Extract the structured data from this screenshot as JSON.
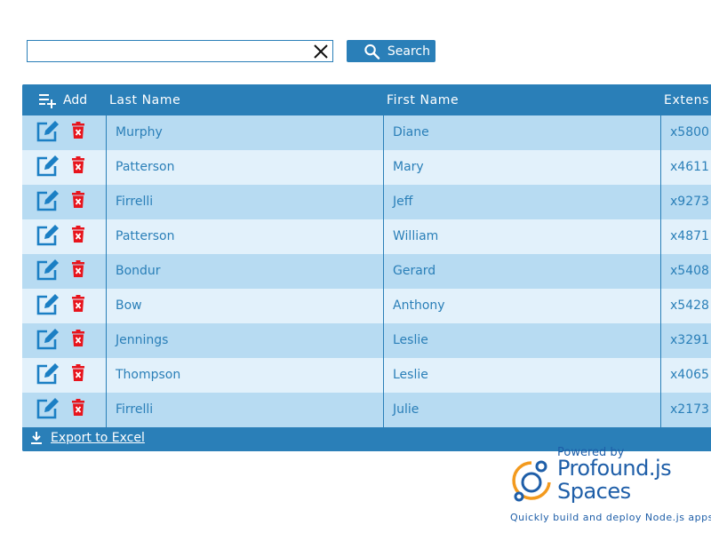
{
  "search": {
    "value": "",
    "button_label": "Search"
  },
  "grid": {
    "add_label": "Add",
    "columns": [
      "Last Name",
      "First Name",
      "Extens"
    ],
    "rows": [
      {
        "last": "Murphy",
        "first": "Diane",
        "ext": "x5800"
      },
      {
        "last": "Patterson",
        "first": "Mary",
        "ext": "x4611"
      },
      {
        "last": "Firrelli",
        "first": "Jeff",
        "ext": "x9273"
      },
      {
        "last": "Patterson",
        "first": "William",
        "ext": "x4871"
      },
      {
        "last": "Bondur",
        "first": "Gerard",
        "ext": "x5408"
      },
      {
        "last": "Bow",
        "first": "Anthony",
        "ext": "x5428"
      },
      {
        "last": "Jennings",
        "first": "Leslie",
        "ext": "x3291"
      },
      {
        "last": "Thompson",
        "first": "Leslie",
        "ext": "x4065"
      },
      {
        "last": "Firrelli",
        "first": "Julie",
        "ext": "x2173"
      }
    ],
    "export_label": "Export to Excel"
  },
  "branding": {
    "powered_by": "Powered by",
    "product_line1": "Profound.js",
    "product_line2": "Spaces",
    "tagline": "Quickly build and deploy Node.js apps"
  },
  "colors": {
    "accent": "#2a7fb8",
    "row_odd": "#b7dbf2",
    "row_even": "#e2f1fb",
    "delete_icon": "#e8141c",
    "brand_blue": "#1e5ea8",
    "logo_orange": "#f39a1e"
  },
  "icons": {
    "search": "magnifier-icon",
    "clear": "close-icon",
    "add": "playlist-add-icon",
    "edit": "edit-icon",
    "delete": "trash-icon",
    "export": "download-icon"
  }
}
